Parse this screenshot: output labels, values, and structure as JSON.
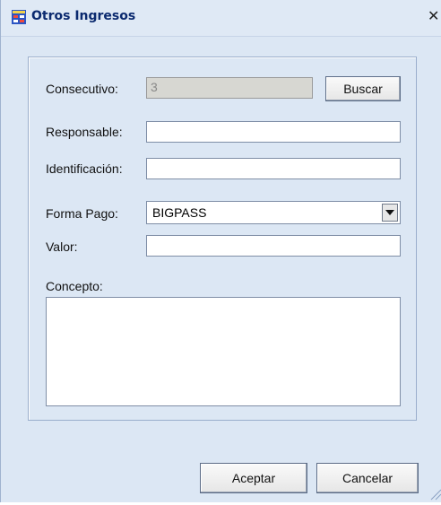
{
  "window": {
    "title": "Otros Ingresos",
    "close_glyph": "✕"
  },
  "form": {
    "consecutivo": {
      "label": "Consecutivo:",
      "value": "3"
    },
    "buscar_label": "Buscar",
    "responsable": {
      "label": "Responsable:",
      "value": ""
    },
    "identificacion": {
      "label": "Identificación:",
      "value": ""
    },
    "forma_pago": {
      "label": "Forma Pago:",
      "value": "BIGPASS"
    },
    "valor": {
      "label": "Valor:",
      "value": ""
    },
    "concepto": {
      "label": "Concepto:",
      "value": ""
    }
  },
  "buttons": {
    "aceptar": "Aceptar",
    "cancelar": "Cancelar"
  },
  "colors": {
    "window_bg": "#dce7f4",
    "title_text": "#0b2a6f",
    "disabled_field": "#d7d7d2"
  },
  "icons": {
    "app": "form-icon",
    "close": "close-icon",
    "dropdown": "chevron-down-icon",
    "resize": "resize-grip-icon"
  }
}
